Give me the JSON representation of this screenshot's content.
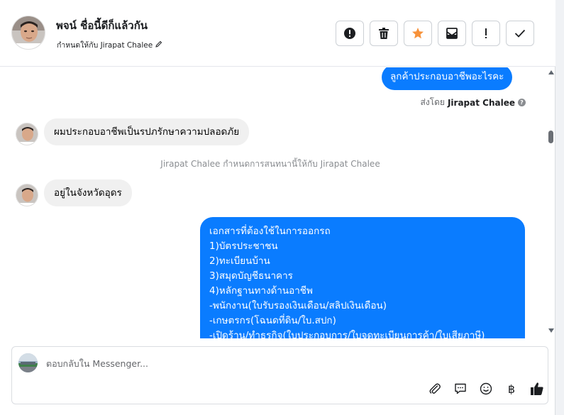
{
  "header": {
    "contact_name": "พจน์ ชื่อนี้ดีก็แล้วกัน",
    "assigned_to": "กำหนดให้กับ Jirapat Chalee",
    "actions": [
      {
        "name": "spam-button",
        "icon": "exclamation-circle-icon"
      },
      {
        "name": "delete-button",
        "icon": "trash-icon"
      },
      {
        "name": "star-button",
        "icon": "star-icon",
        "color": "#f7923a"
      },
      {
        "name": "archive-button",
        "icon": "archive-icon"
      },
      {
        "name": "follow-up-button",
        "icon": "exclamation-icon"
      },
      {
        "name": "mark-done-button",
        "icon": "checkmark-icon"
      }
    ]
  },
  "thread": {
    "messages": [
      {
        "direction": "out",
        "text": "ลูกค้าประกอบอาชีพอะไรคะ"
      },
      {
        "direction": "meta",
        "sent_by_prefix": "ส่งโดย",
        "sent_by_name": "Jirapat Chalee"
      },
      {
        "direction": "in",
        "text": "ผมประกอบอาชีพเป็นรปภรักษาความปลอดภัย"
      },
      {
        "direction": "system",
        "text": "Jirapat Chalee กำหนดการสนทนานี้ให้กับ Jirapat Chalee"
      },
      {
        "direction": "in",
        "text": "อยู่ในจังหวัดอุดร"
      },
      {
        "direction": "out",
        "lines": [
          "เอกสารที่ต้องใช้ในการออกรถ",
          "1)บัตรประชาชน",
          "2)ทะเบียนบ้าน",
          "3)สมุดบัญชีธนาคาร",
          "4)หลักฐานทางด้านอาชีพ",
          "-พนักงาน(ใบรับรองเงินเดือน/สลิปเงินเดือน)",
          "-เกษตรกร(โฉนดที่ดิน/ใบ.สปก)",
          "-เปิดร้าน/ทำธุรกิจ(ใบประกอบการ/ใบจดทะเบียนการค้า/ใบเสียภาษี)"
        ]
      }
    ]
  },
  "composer": {
    "placeholder": "ตอบกลับใน Messenger...",
    "icons": [
      "paperclip-icon",
      "saved-reply-icon",
      "emoji-icon",
      "payment-icon",
      "thumbs-up-icon"
    ],
    "currency_symbol": "฿"
  },
  "colors": {
    "accent": "#0a7cff",
    "incoming_bubble": "#f0f0f0",
    "star": "#f7923a"
  }
}
